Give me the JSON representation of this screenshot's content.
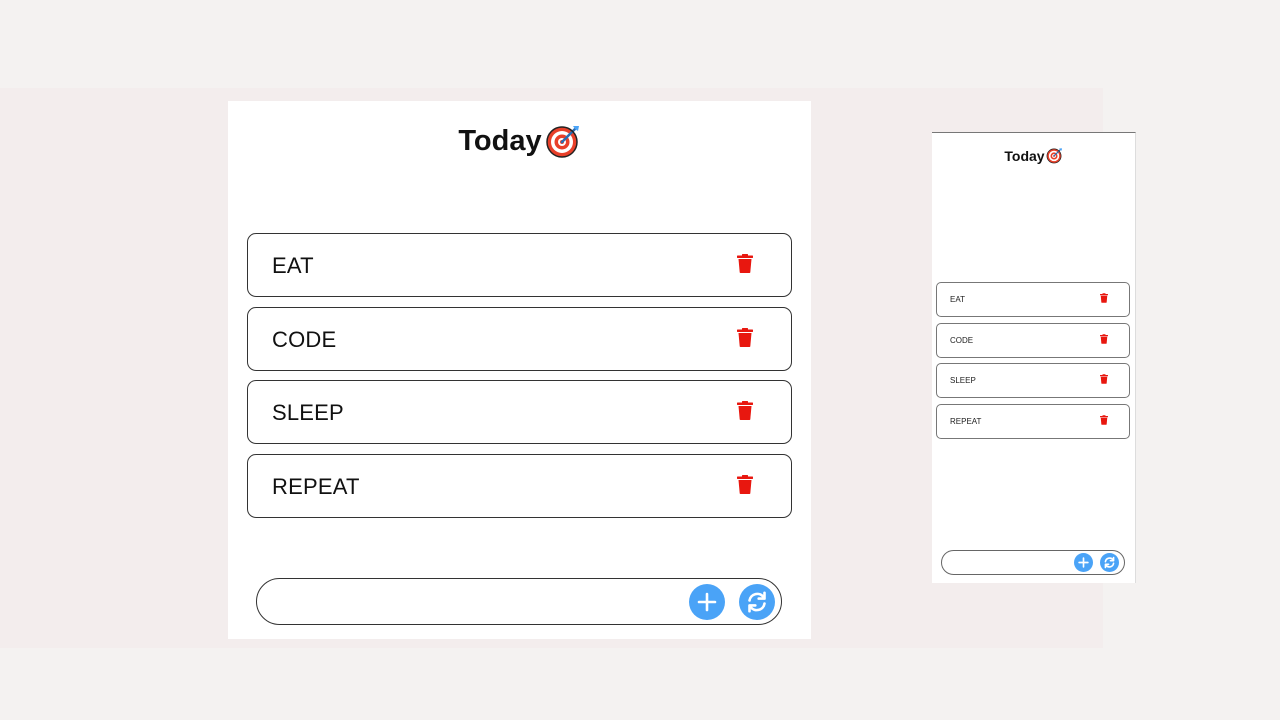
{
  "app": {
    "title": "Today",
    "icon": "target-dart-icon"
  },
  "colors": {
    "trash": "#e8170f",
    "button": "#4aa3f7",
    "page_background": "#f4f2f1",
    "band_background": "#f3eded",
    "card_background": "#ffffff"
  },
  "desktop": {
    "tasks": [
      {
        "label": "EAT",
        "delete_icon": "trash-icon"
      },
      {
        "label": "CODE",
        "delete_icon": "trash-icon"
      },
      {
        "label": "SLEEP",
        "delete_icon": "trash-icon"
      },
      {
        "label": "REPEAT",
        "delete_icon": "trash-icon"
      }
    ],
    "input": {
      "value": "",
      "placeholder": ""
    },
    "buttons": {
      "add_icon": "plus-icon",
      "refresh_icon": "refresh-icon"
    }
  },
  "mobile": {
    "tasks": [
      {
        "label": "EAT",
        "delete_icon": "trash-icon"
      },
      {
        "label": "CODE",
        "delete_icon": "trash-icon"
      },
      {
        "label": "SLEEP",
        "delete_icon": "trash-icon"
      },
      {
        "label": "REPEAT",
        "delete_icon": "trash-icon"
      }
    ],
    "input": {
      "value": "",
      "placeholder": ""
    },
    "buttons": {
      "add_icon": "plus-icon",
      "refresh_icon": "refresh-icon"
    }
  }
}
